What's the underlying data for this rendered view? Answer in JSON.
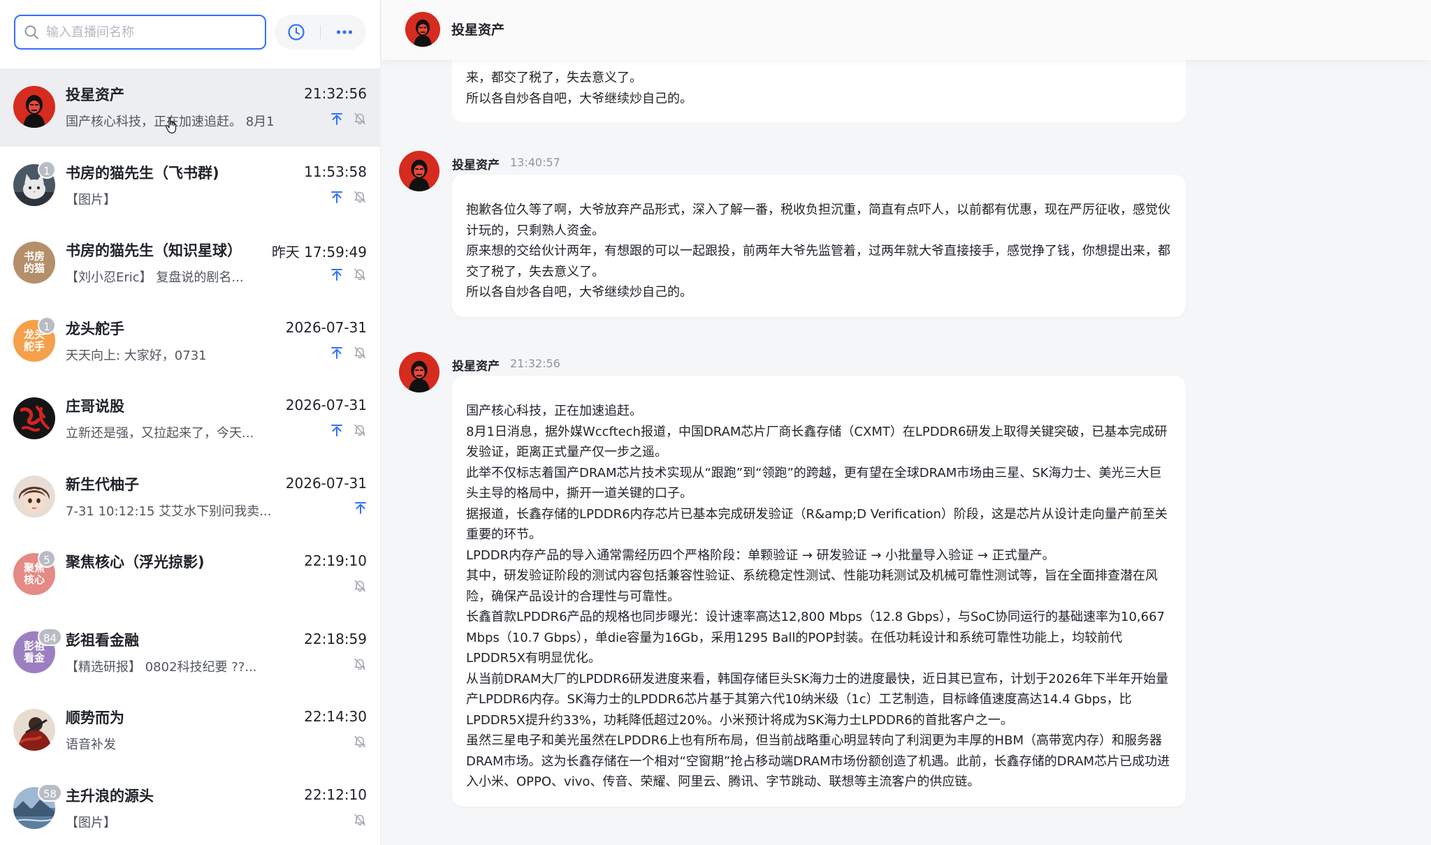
{
  "search": {
    "placeholder": "输入直播间名称"
  },
  "header": {
    "title": "投星资产"
  },
  "colors": {
    "accent": "#3370ff",
    "active_row": "#eceef1",
    "badge": "#b8bcc4"
  },
  "conversations": [
    {
      "name": "投星资产",
      "time": "21:32:56",
      "preview": "国产核心科技，正在加速追赶。 8月1...",
      "badge": "",
      "avatar_text": "",
      "avatar_color": "#d62b1f",
      "avatar_kind": "portrait-red",
      "pinned": true,
      "muted": true,
      "active": true
    },
    {
      "name": "书房的猫先生（飞书群)",
      "time": "11:53:58",
      "preview": "【图片】",
      "badge": "1",
      "avatar_text": "",
      "avatar_color": "#5a6a78",
      "avatar_kind": "cat-photo",
      "pinned": true,
      "muted": true,
      "active": false
    },
    {
      "name": "书房的猫先生（知识星球）",
      "time": "昨天 17:59:49",
      "preview": "【刘小忍Eric】 复盘说的剧名...",
      "badge": "",
      "avatar_text": "书房的猫",
      "avatar_color": "#b58f6a",
      "avatar_kind": "text",
      "pinned": true,
      "muted": true,
      "active": false
    },
    {
      "name": "龙头舵手",
      "time": "2026-07-31",
      "preview": "天天向上: 大家好，0731",
      "badge": "1",
      "avatar_text": "龙头舵手",
      "avatar_color": "#f5a04a",
      "avatar_kind": "text",
      "pinned": true,
      "muted": true,
      "active": false
    },
    {
      "name": "庄哥说股",
      "time": "2026-07-31",
      "preview": "立新还是强，又拉起来了，今天...",
      "badge": "",
      "avatar_text": "庄哥说股",
      "avatar_color": "#1b1b1b",
      "avatar_kind": "calligraphy",
      "pinned": true,
      "muted": true,
      "active": false
    },
    {
      "name": "新生代柚子",
      "time": "2026-07-31",
      "preview": "7-31 10:12:15 艾艾水下别问我卖...",
      "badge": "",
      "avatar_text": "",
      "avatar_color": "#6b4a3a",
      "avatar_kind": "anime",
      "pinned": true,
      "muted": false,
      "active": false
    },
    {
      "name": "聚焦核心（浮光掠影)",
      "time": "22:19:10",
      "preview": "",
      "badge": "5",
      "avatar_text": "聚焦核心",
      "avatar_color": "#e58a86",
      "avatar_kind": "text",
      "pinned": false,
      "muted": true,
      "active": false
    },
    {
      "name": "彭祖看金融",
      "time": "22:18:59",
      "preview": "【精选研报】 0802科技纪要      ??...",
      "badge": "84",
      "avatar_text": "彭祖看金",
      "avatar_color": "#9b7fc0",
      "avatar_kind": "text",
      "pinned": false,
      "muted": true,
      "active": false
    },
    {
      "name": "顺势而为",
      "time": "22:14:30",
      "preview": "语音补发",
      "badge": "",
      "avatar_text": "",
      "avatar_color": "#7a2a22",
      "avatar_kind": "warrior",
      "pinned": false,
      "muted": true,
      "active": false
    },
    {
      "name": "主升浪的源头",
      "time": "22:12:10",
      "preview": "【图片】",
      "badge": "58",
      "avatar_text": "",
      "avatar_color": "#6f8fb0",
      "avatar_kind": "landscape",
      "pinned": false,
      "muted": true,
      "active": false
    }
  ],
  "messages": [
    {
      "sender": "",
      "time": "",
      "partial": true,
      "paragraphs": [
        "来，都交了税了，失去意义了。",
        "所以各自炒各自吧，大爷继续炒自己的。"
      ]
    },
    {
      "sender": "投星资产",
      "time": "13:40:57",
      "partial": false,
      "paragraphs": [
        "抱歉各位久等了啊，大爷放弃产品形式，深入了解一番，税收负担沉重，简直有点吓人，以前都有优惠，现在严厉征收，感觉伙计玩的，只剩熟人资金。",
        "原来想的交给伙计两年，有想跟的可以一起跟投，前两年大爷先监管着，过两年就大爷直接接手，感觉挣了钱，你想提出来，都交了税了，失去意义了。",
        "所以各自炒各自吧，大爷继续炒自己的。"
      ]
    },
    {
      "sender": "投星资产",
      "time": "21:32:56",
      "partial": false,
      "paragraphs": [
        "国产核心科技，正在加速追赶。",
        "8月1日消息，据外媒Wccftech报道，中国DRAM芯片厂商长鑫存储（CXMT）在LPDDR6研发上取得关键突破，已基本完成研发验证，距离正式量产仅一步之遥。",
        "此举不仅标志着国产DRAM芯片技术实现从“跟跑”到“领跑”的跨越，更有望在全球DRAM市场由三星、SK海力士、美光三大巨头主导的格局中，撕开一道关键的口子。",
        "据报道，长鑫存储的LPDDR6内存芯片已基本完成研发验证（R&amp;D Verification）阶段，这是芯片从设计走向量产前至关重要的环节。",
        "LPDDR内存产品的导入通常需经历四个严格阶段：单颗验证 → 研发验证 → 小批量导入验证 → 正式量产。",
        "其中，研发验证阶段的测试内容包括兼容性验证、系统稳定性测试、性能功耗测试及机械可靠性测试等，旨在全面排查潜在风险，确保产品设计的合理性与可靠性。",
        "长鑫首款LPDDR6产品的规格也同步曝光：设计速率高达12,800 Mbps（12.8 Gbps），与SoC协同运行的基础速率为10,667 Mbps（10.7 Gbps），单die容量为16Gb，采用1295 Ball的POP封装。在低功耗设计和系统可靠性功能上，均较前代LPDDR5X有明显优化。",
        "从当前DRAM大厂的LPDDR6研发进度来看，韩国存储巨头SK海力士的进度最快，近日其已宣布，计划于2026年下半年开始量产LPDDR6内存。SK海力士的LPDDR6芯片基于其第六代10纳米级（1c）工艺制造，目标峰值速度高达14.4 Gbps，比LPDDR5X提升约33%，功耗降低超过20%。小米预计将成为SK海力士LPDDR6的首批客户之一。",
        "虽然三星电子和美光虽然在LPDDR6上也有所布局，但当前战略重心明显转向了利润更为丰厚的HBM（高带宽内存）和服务器DRAM市场。这为长鑫存储在一个相对“空窗期”抢占移动端DRAM市场份额创造了机遇。此前，长鑫存储的DRAM芯片已成功进入小米、OPPO、vivo、传音、荣耀、阿里云、腾讯、字节跳动、联想等主流客户的供应链。"
      ]
    }
  ]
}
